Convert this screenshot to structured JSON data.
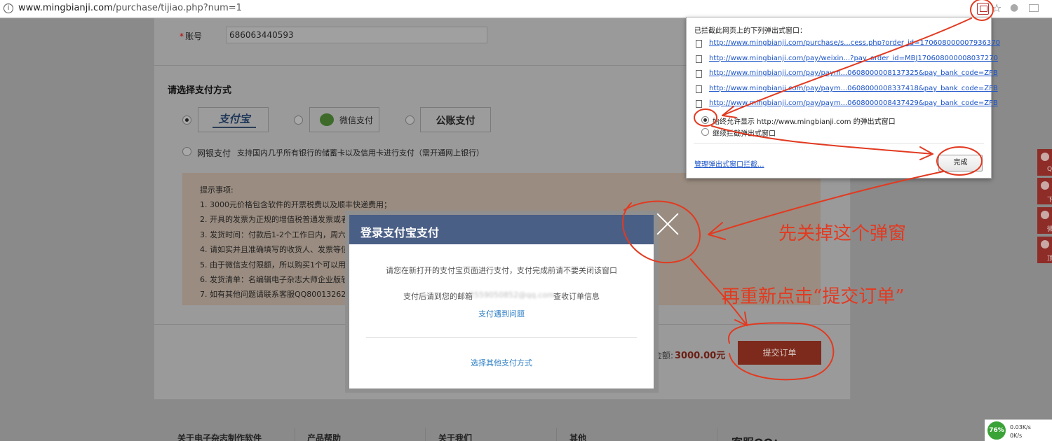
{
  "browser": {
    "url_domain": "www.mingbianji.com",
    "url_path": "/purchase/tijiao.php?num=1"
  },
  "form": {
    "account_label": "账号",
    "account_required": "*",
    "account_value": "686063440593",
    "payment_heading": "请选择支付方式",
    "alipay_label": "支付宝",
    "wechat_label": "微信支付",
    "public_label": "公账支付",
    "bank_label": "网银支付",
    "bank_desc": "支持国内几乎所有银行的储蓄卡以及信用卡进行支付（需开通网上银行）"
  },
  "notice": {
    "title": "提示事项:",
    "lines": [
      "1. 3000元价格包含软件的开票税费以及顺丰快递费用；",
      "2. 开具的发票为正规的增值税普通发票或者",
      "3. 发货时间：付款后1-2个工作日内，周六日",
      "4. 请如实并且准确填写的收货人、发票等信",
      "5. 由于微信支付限额，所以购买1个可以用微",
      "6. 发货清单：名编辑电子杂志大师企业版软",
      "7. 如有其他问题请联系客服QQ800132629"
    ]
  },
  "order": {
    "total_label": "金额:",
    "total_value": "3000.00元",
    "submit_label": "提交订单"
  },
  "footer": {
    "cols": [
      "关于电子杂志制作软件",
      "产品帮助",
      "关于我们",
      "其他",
      "客服QQ："
    ]
  },
  "side_tabs": [
    "QQ",
    "下",
    "微",
    "顶"
  ],
  "tray": {
    "badge": "76%",
    "up_speed": "0.03K/s",
    "down_speed": "0K/s"
  },
  "modal": {
    "title": "登录支付宝支付",
    "message1": "请您在新打开的支付宝页面进行支付，支付完成前请不要关闭该窗口",
    "message2_prefix": "支付后请到您的邮箱",
    "email": "2559050852@qq.com",
    "message2_suffix": "查收订单信息",
    "trouble_link": "支付遇到问题",
    "other_link": "选择其他支付方式"
  },
  "popup_blocker": {
    "title": "已拦截此网页上的下列弹出式窗口：",
    "links": [
      "http://www.mingbianji.com/purchase/s...cess.php?order_id=170608000007936370",
      "http://www.mingbianji.com/pay/weixin...?pay_order_id=MBJ170608000008037270",
      "http://www.mingbianji.com/pay/paym...0608000008137325&pay_bank_code=ZFB",
      "http://www.mingbianji.com/pay/paym...0608000008337418&pay_bank_code=ZFB",
      "http://www.mingbianji.com/pay/paym...0608000008437429&pay_bank_code=ZFB"
    ],
    "option_allow": "始终允许显示 http://www.mingbianji.com 的弹出式窗口",
    "option_block": "继续拦截弹出式窗口",
    "manage_link": "管理弹出式窗口拦截...",
    "done_button": "完成"
  },
  "annotations": {
    "close_popup": "先关掉这个弹窗",
    "resubmit": "再重新点击“提交订单”",
    "color": "#e23a21"
  }
}
